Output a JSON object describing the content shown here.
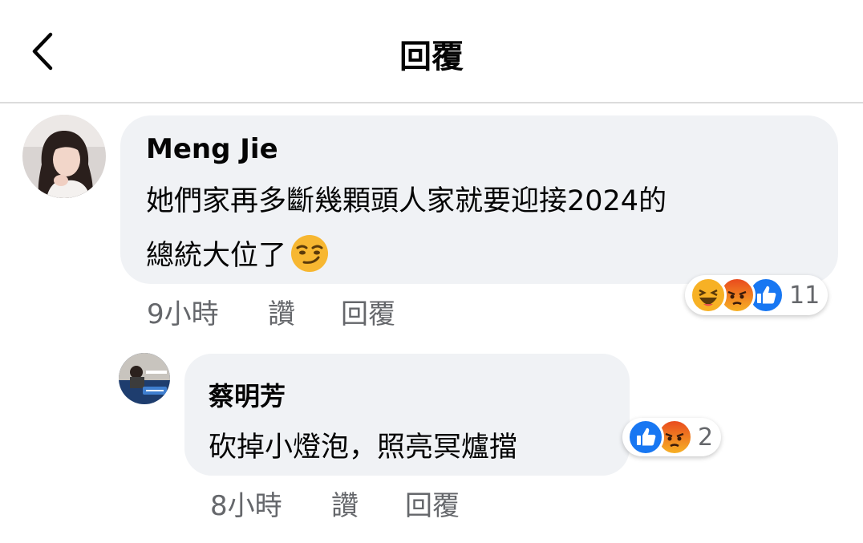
{
  "header": {
    "title": "回覆"
  },
  "comment": {
    "author": "Meng Jie",
    "line1": "她們家再多斷幾顆頭人家就要迎接2024的",
    "line2": "總統大位了",
    "emoji": "smirk-face",
    "time": "9小時",
    "like_label": "讚",
    "reply_label": "回覆",
    "reaction_count": "11",
    "reactions": [
      "haha",
      "angry",
      "like"
    ]
  },
  "reply": {
    "author": "蔡明芳",
    "text": "砍掉小燈泡，照亮冥爐擋",
    "time": "8小時",
    "like_label": "讚",
    "reply_label": "回覆",
    "reaction_count": "2",
    "reactions": [
      "like",
      "angry"
    ]
  },
  "colors": {
    "bubble": "#f0f2f5",
    "like_blue": "#1877f2",
    "angry_orange": "#f25c21",
    "haha_yellow": "#f7b125",
    "meta_gray": "#65676b"
  }
}
